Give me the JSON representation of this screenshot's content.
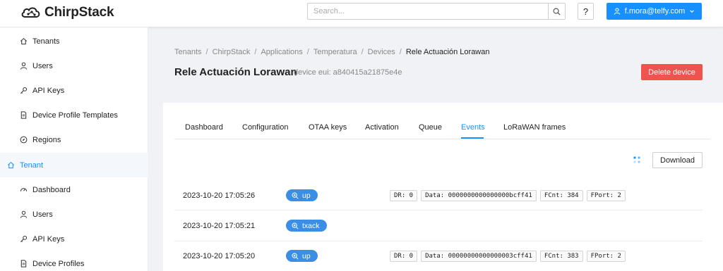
{
  "app": {
    "name": "ChirpStack",
    "brand_color": "#1890ff"
  },
  "header": {
    "search_placeholder": "Search...",
    "help_label": "?",
    "user_label": "f.mora@telfy.com"
  },
  "sidebar": {
    "items": [
      {
        "label": "Tenants",
        "icon": "home-icon"
      },
      {
        "label": "Users",
        "icon": "user-icon"
      },
      {
        "label": "API Keys",
        "icon": "key-icon"
      },
      {
        "label": "Device Profile Templates",
        "icon": "document-icon"
      },
      {
        "label": "Regions",
        "icon": "compass-icon"
      },
      {
        "label": "Tenant",
        "icon": "home-icon",
        "group": true
      },
      {
        "label": "Dashboard",
        "icon": "dashboard-icon"
      },
      {
        "label": "Users",
        "icon": "user-icon"
      },
      {
        "label": "API Keys",
        "icon": "key-icon"
      },
      {
        "label": "Device Profiles",
        "icon": "document-icon"
      }
    ]
  },
  "breadcrumb": [
    "Tenants",
    "ChirpStack",
    "Applications",
    "Temperatura",
    "Devices",
    "Rele Actuación Lorawan"
  ],
  "page": {
    "title": "Rele Actuación Lorawan",
    "subtitle": "device eui: a840415a21875e4e",
    "delete_label": "Delete device",
    "delete_color": "#ef5350"
  },
  "tabs": [
    "Dashboard",
    "Configuration",
    "OTAA keys",
    "Activation",
    "Queue",
    "Events",
    "LoRaWAN frames"
  ],
  "active_tab": "Events",
  "download_label": "Download",
  "events": [
    {
      "time": "2023-10-20 17:05:26",
      "type": "up",
      "chips": [
        "DR: 0",
        "Data: 0000000000000000bcff41",
        "FCnt: 384",
        "FPort: 2"
      ]
    },
    {
      "time": "2023-10-20 17:05:21",
      "type": "txack",
      "chips": []
    },
    {
      "time": "2023-10-20 17:05:20",
      "type": "up",
      "chips": [
        "DR: 0",
        "Data: 00000000000000003cff41",
        "FCnt: 383",
        "FPort: 2"
      ]
    }
  ]
}
